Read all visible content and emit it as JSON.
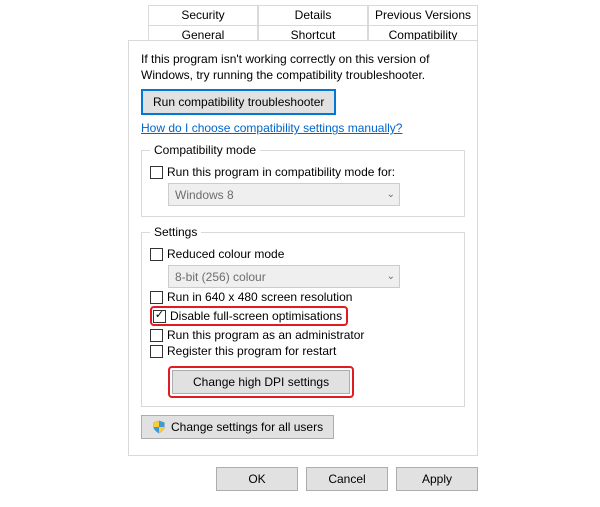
{
  "tabs": {
    "row1": [
      "Security",
      "Details",
      "Previous Versions"
    ],
    "row2": [
      "General",
      "Shortcut",
      "Compatibility"
    ]
  },
  "intro": "If this program isn't working correctly on this version of Windows, try running the compatibility troubleshooter.",
  "troubleshoot_btn": "Run compatibility troubleshooter",
  "help_link": "How do I choose compatibility settings manually?",
  "compat_mode": {
    "legend": "Compatibility mode",
    "checkbox_label": "Run this program in compatibility mode for:",
    "select_value": "Windows 8"
  },
  "settings": {
    "legend": "Settings",
    "reduced_colour": "Reduced colour mode",
    "colour_select": "8-bit (256) colour",
    "run_640": "Run in 640 x 480 screen resolution",
    "disable_fs": "Disable full-screen optimisations",
    "run_admin": "Run this program as an administrator",
    "register_restart": "Register this program for restart",
    "dpi_btn": "Change high DPI settings"
  },
  "all_users_btn": "Change settings for all users",
  "actions": {
    "ok": "OK",
    "cancel": "Cancel",
    "apply": "Apply"
  }
}
